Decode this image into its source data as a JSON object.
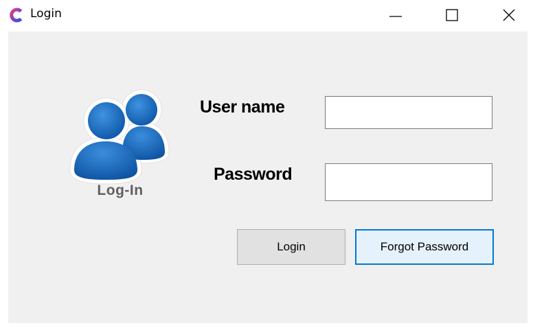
{
  "window": {
    "title": "Login",
    "controls": {
      "minimize_icon": "minimize-icon",
      "maximize_icon": "maximize-icon",
      "close_icon": "close-icon"
    }
  },
  "logo": {
    "icon": "users-icon",
    "caption": "Log-In",
    "color": "#1a6bbf"
  },
  "form": {
    "username_label": "User name",
    "username_value": "",
    "password_label": "Password",
    "password_value": ""
  },
  "buttons": {
    "login_label": "Login",
    "forgot_label": "Forgot Password"
  },
  "colors": {
    "client_bg": "#f0f0f0",
    "focus_border": "#0078d7",
    "focus_fill": "#e5f1fb"
  }
}
